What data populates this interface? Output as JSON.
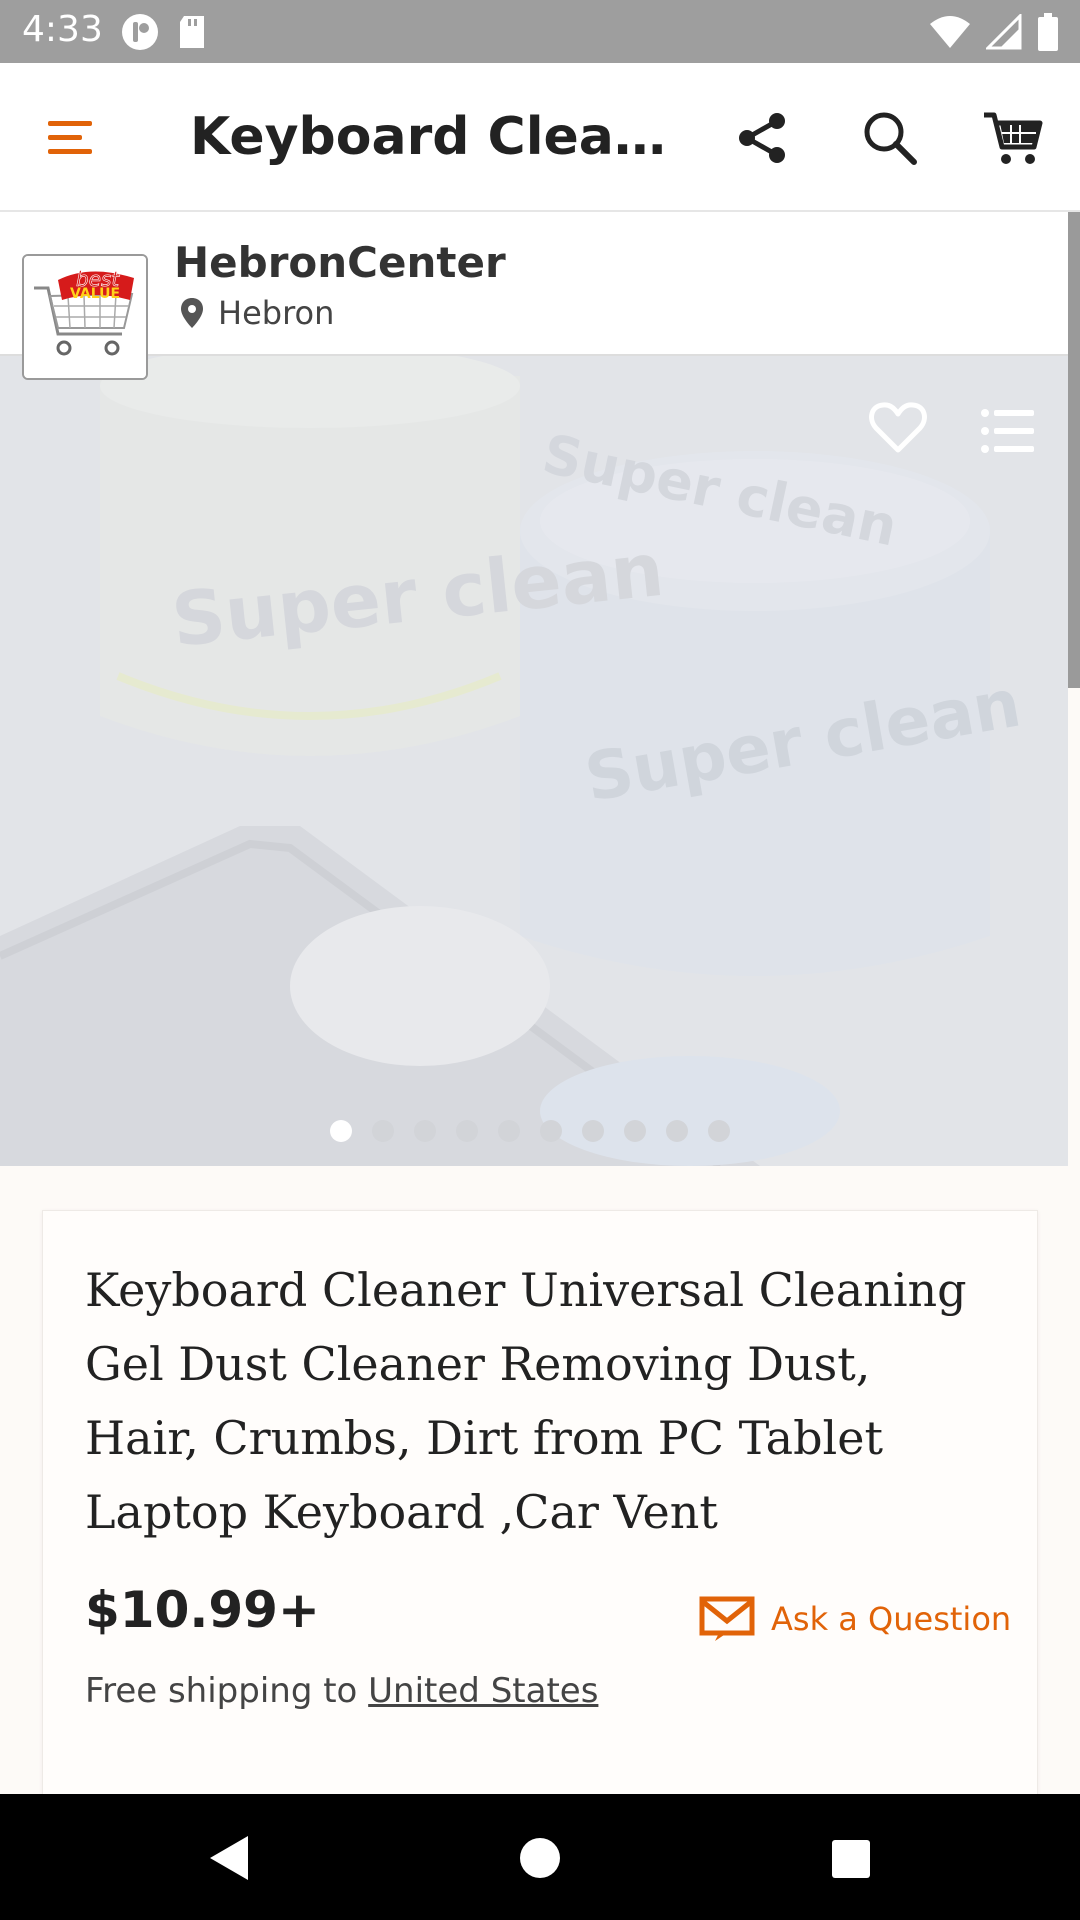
{
  "status_bar": {
    "time": "4:33"
  },
  "app_bar": {
    "title": "Keyboard Cleane...",
    "icons": [
      "menu-icon",
      "share-icon",
      "search-icon",
      "cart-icon"
    ],
    "accent_color": "#e16308"
  },
  "shop": {
    "name": "HebronCenter",
    "location": "Hebron",
    "logo_text": "best VALUE"
  },
  "gallery": {
    "image_count": 10,
    "active_index": 0,
    "image_text": [
      "Super clean",
      "Super clean",
      "Super clean"
    ]
  },
  "product": {
    "title": "Keyboard Cleaner Universal Cleaning Gel Dust Cleaner Removing Dust, Hair, Crumbs, Dirt from PC Tablet Laptop Keyboard ,Car Vent",
    "price": "$10.99+",
    "ask_label": "Ask a Question",
    "shipping_prefix": "Free shipping to",
    "shipping_destination": "United States"
  },
  "nav_bar": {
    "icons": [
      "back-icon",
      "home-icon",
      "recents-icon"
    ]
  }
}
